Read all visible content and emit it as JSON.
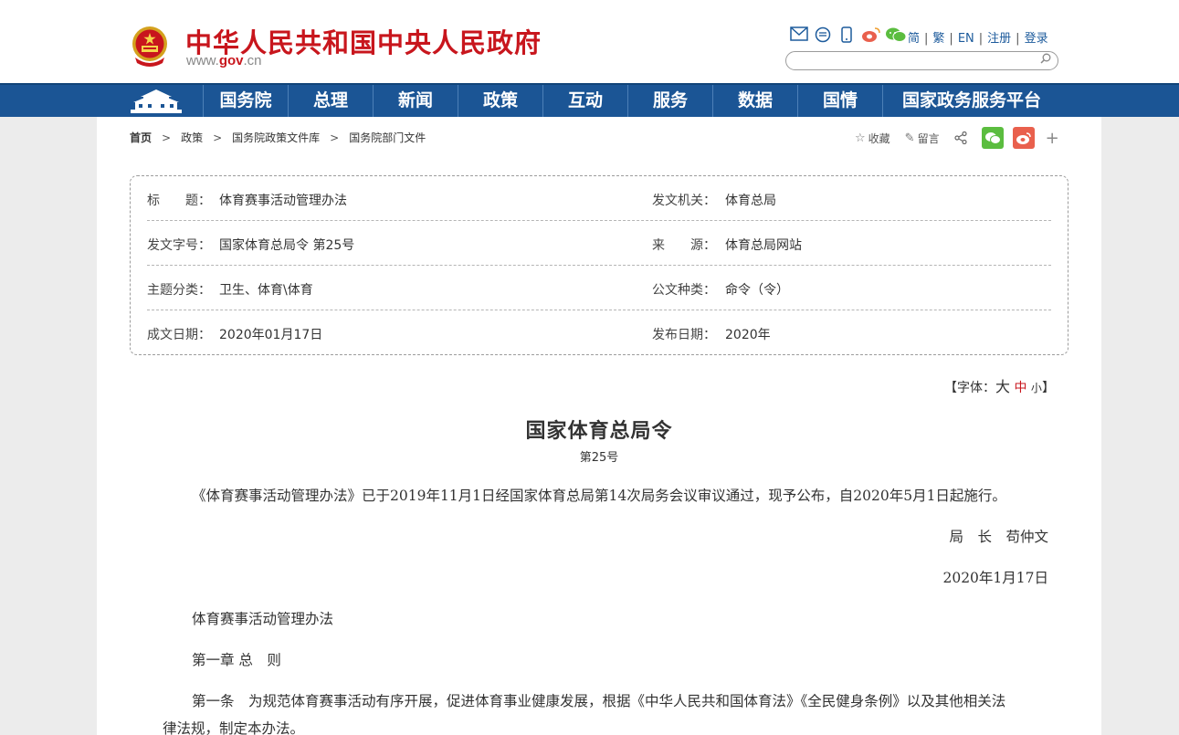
{
  "header": {
    "site_title": "中华人民共和国中央人民政府",
    "url_prefix": "www.",
    "url_brand": "gov",
    "url_suffix": ".cn",
    "tool_icons": [
      "mail-icon",
      "rss-icon",
      "mobile-icon",
      "weibo-icon",
      "wechat-icon"
    ],
    "lang_links": [
      "简",
      "繁",
      "EN",
      "注册",
      "登录"
    ],
    "search_placeholder": ""
  },
  "nav": {
    "items": [
      "国务院",
      "总理",
      "新闻",
      "政策",
      "互动",
      "服务",
      "数据",
      "国情",
      "国家政务服务平台"
    ]
  },
  "breadcrumb": {
    "home": "首页",
    "items": [
      "政策",
      "国务院政策文件库",
      "国务院部门文件"
    ]
  },
  "actions": {
    "favorite": "收藏",
    "comment": "留言"
  },
  "info": {
    "title_label": "标　　题：",
    "title_value": "体育赛事活动管理办法",
    "issuer_label": "发文机关：",
    "issuer_value": "体育总局",
    "doc_no_label": "发文字号：",
    "doc_no_value": "国家体育总局令 第25号",
    "source_label": "来　　源：",
    "source_value": "体育总局网站",
    "topic_label": "主题分类：",
    "topic_value": "卫生、体育\\体育",
    "type_label": "公文种类：",
    "type_value": "命令（令）",
    "written_label": "成文日期：",
    "written_value": "2020年01月17日",
    "published_label": "发布日期：",
    "published_value": "2020年"
  },
  "font_size": {
    "prefix": "【字体：",
    "big": "大",
    "mid": "中",
    "small": "小",
    "suffix": "】"
  },
  "doc": {
    "title": "国家体育总局令",
    "number": "第25号",
    "intro": "《体育赛事活动管理办法》已于2019年11月1日经国家体育总局第14次局务会议审议通过，现予公布，自2020年5月1日起施行。",
    "signature": "局　长　苟仲文",
    "date": "2020年1月17日",
    "law_title": "体育赛事活动管理办法",
    "chapter": "第一章 总　则",
    "article1_line1": "第一条　为规范体育赛事活动有序开展，促进体育事业健康发展，根据《中华人民共和国体育法》《全民健身条例》以及其他相关法",
    "article1_line2": "律法规，制定本办法。"
  },
  "colors": {
    "brand_red": "#c8161d",
    "nav_blue": "#1b5595"
  }
}
